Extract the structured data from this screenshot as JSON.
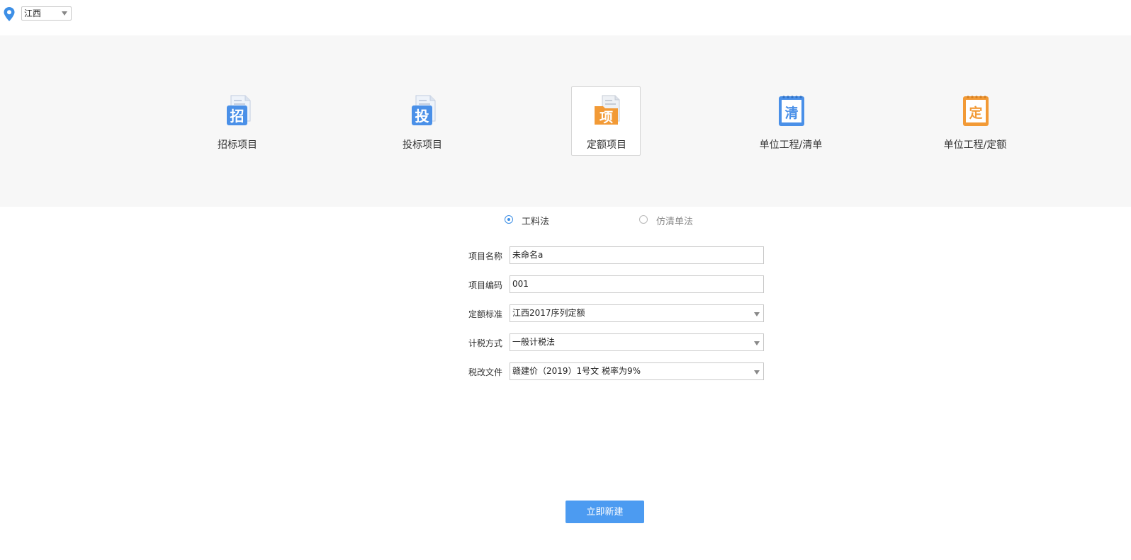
{
  "region": {
    "label": "江西"
  },
  "project_types": [
    {
      "label": "招标项目",
      "icon_char": "招",
      "icon": "bid-tender-doc-icon",
      "color": "#4a90e8"
    },
    {
      "label": "投标项目",
      "icon_char": "投",
      "icon": "bid-submit-doc-icon",
      "color": "#4a90e8"
    },
    {
      "label": "定额项目",
      "icon_char": "项",
      "icon": "quota-project-folder-icon",
      "color": "#f29a36",
      "selected": true
    },
    {
      "label": "单位工程/清单",
      "icon_char": "清",
      "icon": "unit-list-notebook-icon",
      "color": "#4a90e8"
    },
    {
      "label": "单位工程/定额",
      "icon_char": "定",
      "icon": "unit-quota-notebook-icon",
      "color": "#f29a36"
    }
  ],
  "methods": [
    {
      "label": "工料法",
      "checked": true
    },
    {
      "label": "仿清单法",
      "checked": false
    }
  ],
  "form": {
    "name_label": "项目名称",
    "name_value": "未命名a",
    "code_label": "项目编码",
    "code_value": "001",
    "standard_label": "定额标准",
    "standard_value": "江西2017序列定额",
    "tax_method_label": "计税方式",
    "tax_method_value": "一般计税法",
    "tax_doc_label": "税改文件",
    "tax_doc_value": "赣建价（2019）1号文 税率为9%"
  },
  "create_button": "立即新建",
  "colors": {
    "accent": "#4c9bf1",
    "blue_icon": "#4a90e8",
    "orange_icon": "#f29a36",
    "band": "#f7f7f7"
  }
}
